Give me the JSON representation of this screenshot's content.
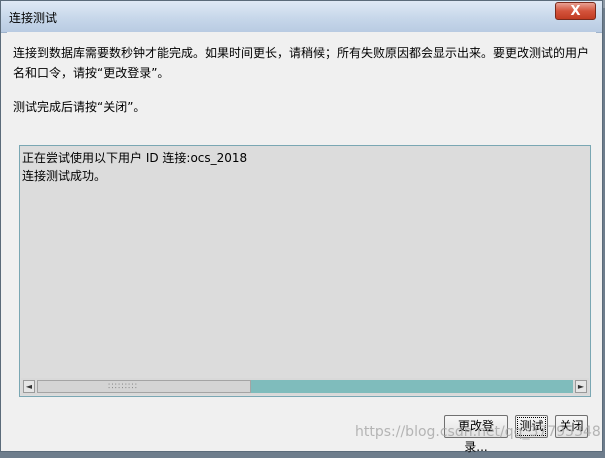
{
  "window": {
    "title": "连接测试",
    "close_glyph": "X"
  },
  "content": {
    "description": "连接到数据库需要数秒钟才能完成。如果时间更长，请稍候；所有失败原因都会显示出来。要更改测试的用户名和口令，请按“更改登录”。",
    "note": "测试完成后请按“关闭”。",
    "output_lines": [
      "正在尝试使用以下用户 ID 连接:ocs_2018",
      "连接测试成功。"
    ]
  },
  "scrollbar": {
    "thumb_fraction": 0.4,
    "left_arrow": "◄",
    "right_arrow": "►"
  },
  "buttons": {
    "modify_login": "更改登录...",
    "test": "测试",
    "close": "关闭"
  },
  "watermark": "https://blog.csdn.net/qq_37795348",
  "colors": {
    "output_bg": "#dcdcdc",
    "scroll_track": "#7fbcbc",
    "close_button": "#d3533c"
  }
}
